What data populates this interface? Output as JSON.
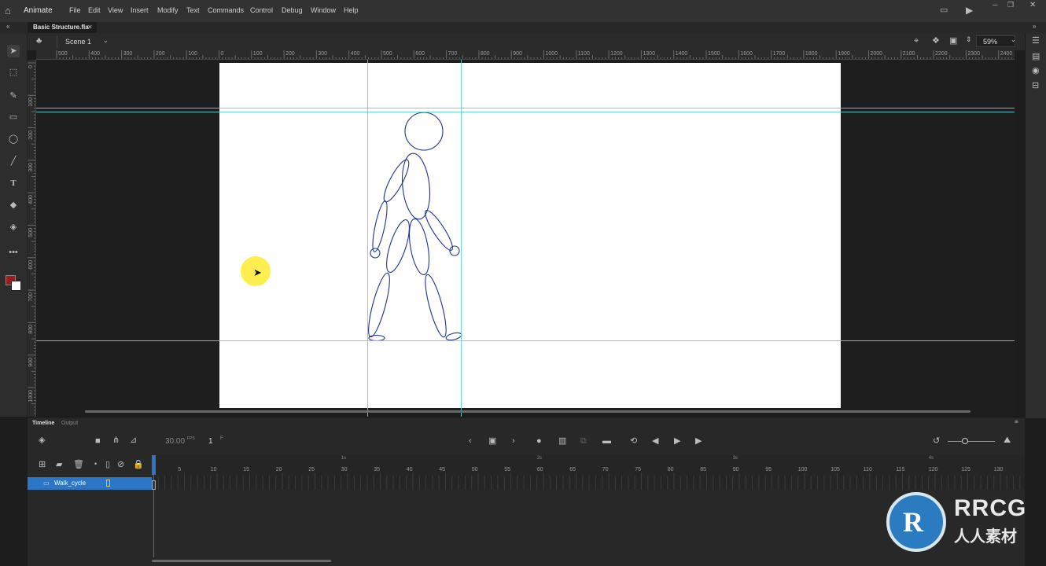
{
  "app": {
    "name": "Animate",
    "menus": [
      "File",
      "Edit",
      "View",
      "Insert",
      "Modify",
      "Text",
      "Commands",
      "Control",
      "Debug",
      "Window",
      "Help"
    ]
  },
  "document": {
    "tab_title": "Basic Structure.fla",
    "scene": "Scene 1",
    "zoom": "59%"
  },
  "rulers": {
    "horizontal": [
      "500",
      "400",
      "300",
      "200",
      "100",
      "0",
      "100",
      "200",
      "300",
      "400",
      "500",
      "600",
      "700",
      "800",
      "900",
      "1000",
      "1100",
      "1200",
      "1300",
      "1400",
      "1500",
      "1600",
      "1700",
      "1800",
      "1900",
      "2000",
      "2100",
      "2200",
      "2300",
      "2400"
    ],
    "vertical": [
      "0",
      "100",
      "200",
      "300",
      "400",
      "500",
      "600",
      "700",
      "800",
      "900",
      "1000"
    ]
  },
  "timeline": {
    "tabs": [
      "Timeline",
      "Output"
    ],
    "fps": "30.00",
    "fps_unit": "FPS",
    "current_frame": "1",
    "frame_unit": "F",
    "seconds": [
      "1s",
      "2s",
      "3s",
      "4s"
    ],
    "frame_numbers": [
      "5",
      "10",
      "15",
      "20",
      "25",
      "30",
      "35",
      "40",
      "45",
      "50",
      "55",
      "60",
      "65",
      "70",
      "75",
      "80",
      "85",
      "90",
      "95",
      "100",
      "105",
      "110",
      "115",
      "120",
      "125",
      "130"
    ],
    "layers": [
      {
        "name": "Walk_cycle"
      }
    ]
  },
  "colors": {
    "accent": "#2b76c6",
    "guide": "#5fd3dd",
    "stroke": "#1e3296",
    "fill_swatch": "#9b1c1c"
  },
  "watermark": {
    "brand": "RRCG",
    "sub": "人人素材"
  }
}
